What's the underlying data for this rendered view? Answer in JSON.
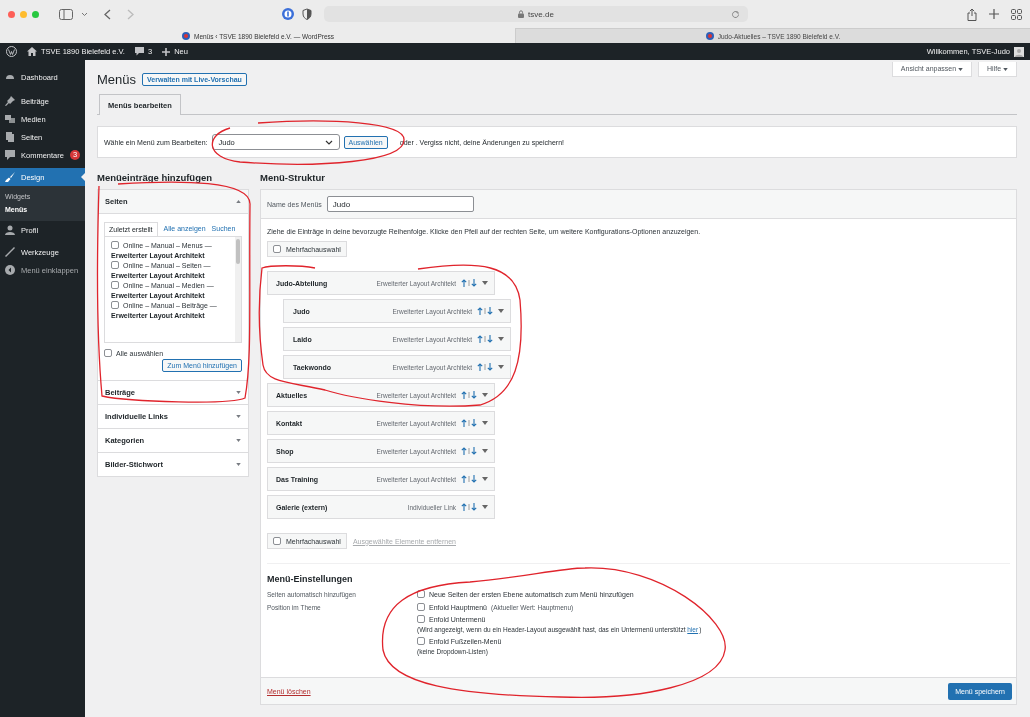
{
  "browser": {
    "address": "tsve.de",
    "tabs": [
      {
        "title": "Menüs ‹ TSVE 1890 Bielefeld e.V. — WordPress",
        "selected": true
      },
      {
        "title": "Judo-Aktuelles – TSVE 1890 Bielefeld e.V.",
        "selected": false
      }
    ]
  },
  "admin_bar": {
    "site": "TSVE 1890 Bielefeld e.V.",
    "comments": "3",
    "new": "Neu",
    "greeting": "Willkommen, TSVE-Judo"
  },
  "sidebar": {
    "items": [
      {
        "label": "Dashboard",
        "selected": false
      },
      {
        "label": "Beiträge",
        "selected": false
      },
      {
        "label": "Medien",
        "selected": false
      },
      {
        "label": "Seiten",
        "selected": false
      },
      {
        "label": "Kommentare",
        "badge": "3",
        "selected": false
      },
      {
        "label": "Design",
        "selected": true,
        "children": [
          {
            "label": "Widgets",
            "selected": false
          },
          {
            "label": "Menüs",
            "selected": true
          }
        ]
      },
      {
        "label": "Profil",
        "selected": false
      },
      {
        "label": "Werkzeuge",
        "selected": false
      }
    ],
    "collapse": "Menü einklappen"
  },
  "page": {
    "title": "Menüs",
    "preview_button": "Verwalten mit Live-Vorschau",
    "screen_buttons": [
      "Ansicht anpassen",
      "Hilfe"
    ],
    "tabs": [
      {
        "label": "Menüs bearbeiten",
        "selected": true
      }
    ],
    "select_bar": {
      "label": "Wähle ein Menü zum Bearbeiten:",
      "value": "Judo",
      "button": "Auswählen",
      "note": "oder . Vergiss nicht, deine Änderungen zu speichern!"
    }
  },
  "add_panel": {
    "heading": "Menüeinträge hinzufügen",
    "sections": [
      {
        "title": "Seiten",
        "expanded": true,
        "tabs": [
          {
            "label": "Zuletzt erstellt",
            "selected": true
          },
          {
            "label": "Alle anzeigen",
            "selected": false
          },
          {
            "label": "Suchen",
            "selected": false
          }
        ],
        "items": [
          {
            "title": "Online – Manual – Menus —",
            "subtitle": "Erweiterter Layout Architekt",
            "checked": false
          },
          {
            "title": "Online – Manual – Seiten —",
            "subtitle": "Erweiterter Layout Architekt",
            "checked": false
          },
          {
            "title": "Online – Manual – Medien —",
            "subtitle": "Erweiterter Layout Architekt",
            "checked": false
          },
          {
            "title": "Online – Manual – Beiträge —",
            "subtitle": "Erweiterter Layout Architekt",
            "checked": false
          }
        ],
        "select_all": {
          "label": "Alle auswählen",
          "checked": false
        },
        "button": "Zum Menü hinzufügen"
      },
      {
        "title": "Beiträge",
        "expanded": false
      },
      {
        "title": "Individuelle Links",
        "expanded": false
      },
      {
        "title": "Kategorien",
        "expanded": false
      },
      {
        "title": "Bilder-Stichwort",
        "expanded": false
      }
    ]
  },
  "structure": {
    "heading": "Menü-Struktur",
    "name_label": "Name des Menüs",
    "name_value": "Judo",
    "instructions": "Ziehe die Einträge in deine bevorzugte Reihenfolge. Klicke den Pfeil auf der rechten Seite, um weitere Konfigurations-Optionen anzuzeigen.",
    "bulk_select": {
      "label": "Mehrfachauswahl",
      "checked": false
    },
    "items": [
      {
        "title": "Judo-Abteilung",
        "type": "Erweiterter Layout Architekt",
        "children": [
          {
            "title": "Judo",
            "type": "Erweiterter Layout Architekt"
          },
          {
            "title": "Laido",
            "type": "Erweiterter Layout Architekt"
          },
          {
            "title": "Taekwondo",
            "type": "Erweiterter Layout Architekt"
          }
        ]
      },
      {
        "title": "Aktuelles",
        "type": "Erweiterter Layout Architekt"
      },
      {
        "title": "Kontakt",
        "type": "Erweiterter Layout Architekt"
      },
      {
        "title": "Shop",
        "type": "Erweiterter Layout Architekt"
      },
      {
        "title": "Das Training",
        "type": "Erweiterter Layout Architekt"
      },
      {
        "title": "Galerie (extern)",
        "type": "Individueller Link"
      }
    ],
    "bulk_select_bottom": {
      "label": "Mehrfachauswahl",
      "checked": false
    },
    "remove_link": "Ausgewählte Elemente entfernen",
    "settings": {
      "heading": "Menü-Einstellungen",
      "rows": [
        {
          "label": "Seiten automatisch hinzufügen",
          "options": [
            {
              "label": "Neue Seiten der ersten Ebene automatisch zum Menü hinzufügen",
              "checked": false
            }
          ]
        },
        {
          "label": "Position im Theme",
          "options": [
            {
              "label": "Enfold Hauptmenü",
              "note": "(Aktueller Wert: Hauptmenu)",
              "checked": false
            },
            {
              "label": "Enfold Untermenü",
              "hint": "(Wird angezeigt, wenn du ein Header-Layout ausgewählt hast, das ein Untermenü unterstützt",
              "hint_link": "hier",
              "hint_end": ")",
              "checked": false
            },
            {
              "label": "Enfold Fußzeilen-Menü",
              "hint": "(keine Dropdown-Listen)",
              "checked": false
            }
          ]
        }
      ]
    },
    "delete_link": "Menü löschen",
    "save_button": "Menü speichern"
  }
}
